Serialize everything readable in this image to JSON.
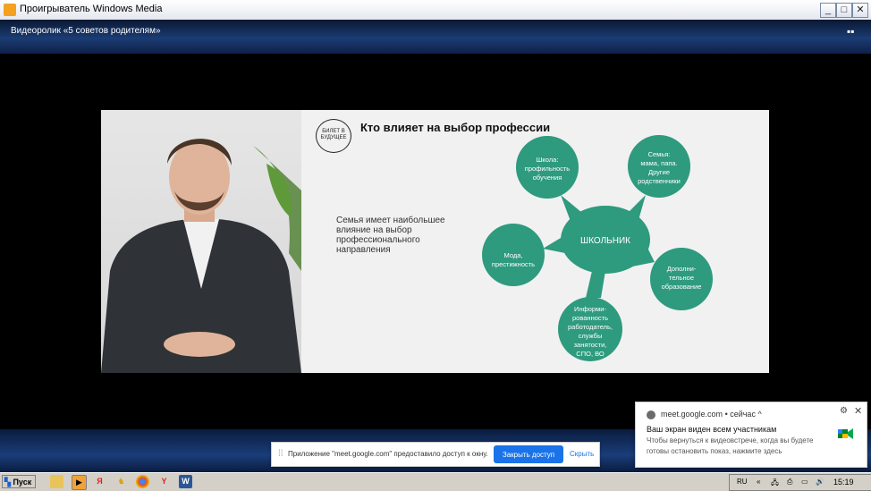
{
  "window": {
    "title": "Проигрыватель Windows Media"
  },
  "header": {
    "video_title": "Видеоролик «5 советов родителям»"
  },
  "slide": {
    "logo_text": "БИЛЕТ В БУДУЩЕЕ",
    "heading": "Кто влияет на выбор профессии",
    "left_text": "Семья имеет наибольшее влияние на выбор профессионального направления",
    "center": "ШКОЛЬНИК",
    "nodes": [
      "Школа: профильность обучения",
      "Семья: мама, папа. Другие родственники",
      "Мода, престижность",
      "Дополни-тельное образование",
      "Информи-рованность работодатель, службы занятости, СПО, ВО"
    ],
    "node_color": "#2e9a7e"
  },
  "share_bar": {
    "message": "Приложение \"meet.google.com\" предоставило доступ к окну.",
    "share_button": "Закрыть доступ",
    "hide_link": "Скрыть"
  },
  "notification": {
    "source": "meet.google.com",
    "time": "• сейчас ^",
    "title": "Ваш экран виден всем участникам",
    "body": "Чтобы вернуться к видеовстрече, когда вы будете готовы остановить показ, нажмите здесь"
  },
  "taskbar": {
    "start_label": "Пуск",
    "language": "RU",
    "time": "15:19",
    "icons": [
      "folder-icon",
      "media-player-icon",
      "yandex-icon",
      "app-icon",
      "chrome-icon",
      "yandex-browser-icon",
      "word-icon"
    ]
  }
}
